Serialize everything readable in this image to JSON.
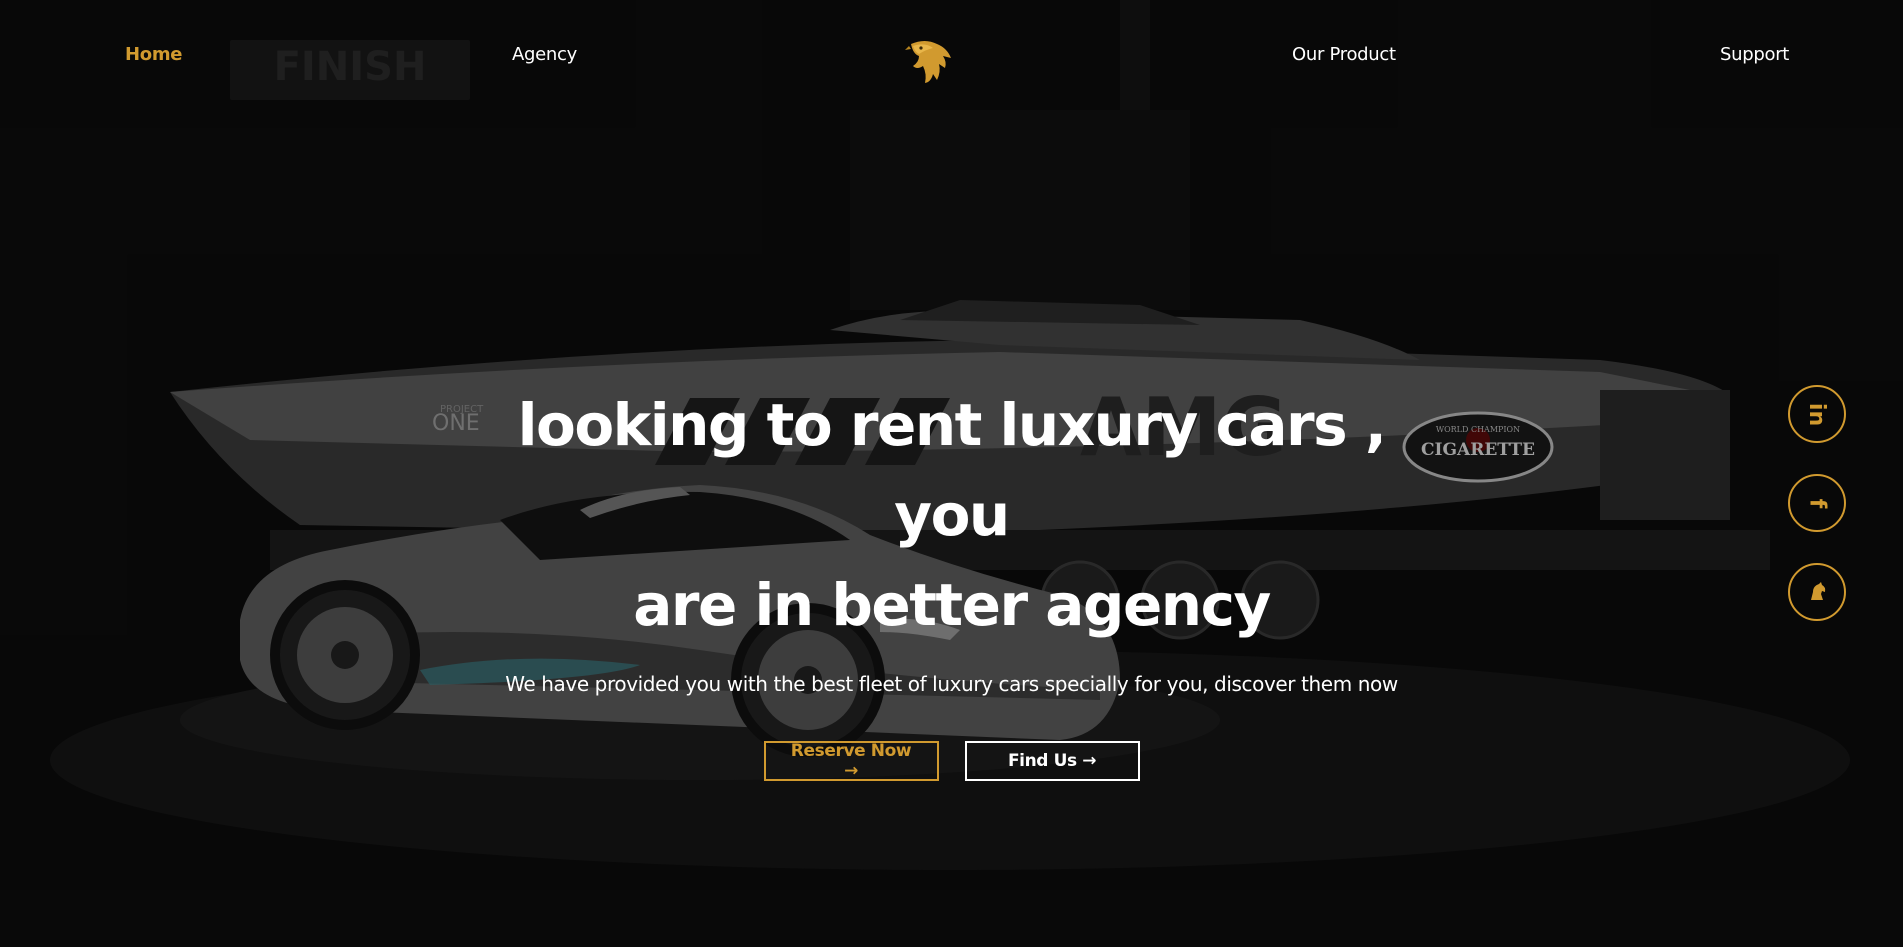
{
  "nav": {
    "home": "Home",
    "agency": "Agency",
    "product": "Our Product",
    "support": "Support"
  },
  "hero": {
    "headline_line1": "looking to rent luxury cars , you",
    "headline_line2": "are in better agency",
    "subtitle": "We have provided you with the best fleet of luxury cars specially for you, discover them now",
    "reserve_label": "Reserve Now →",
    "find_label": "Find Us →"
  },
  "social": {
    "linkedin_glyph": "in",
    "facebook_glyph": "f",
    "third_icon": "horse-icon"
  },
  "background_text": {
    "finish": "FINISH",
    "one": "ONE",
    "project": "PROJECT",
    "cigarette": "CIGARETTE",
    "world_champion": "WORLD CHAMPION",
    "boat_model": "AMG"
  },
  "colors": {
    "accent": "#d19a2f",
    "text": "#ffffff",
    "background": "#0b0b0b"
  }
}
